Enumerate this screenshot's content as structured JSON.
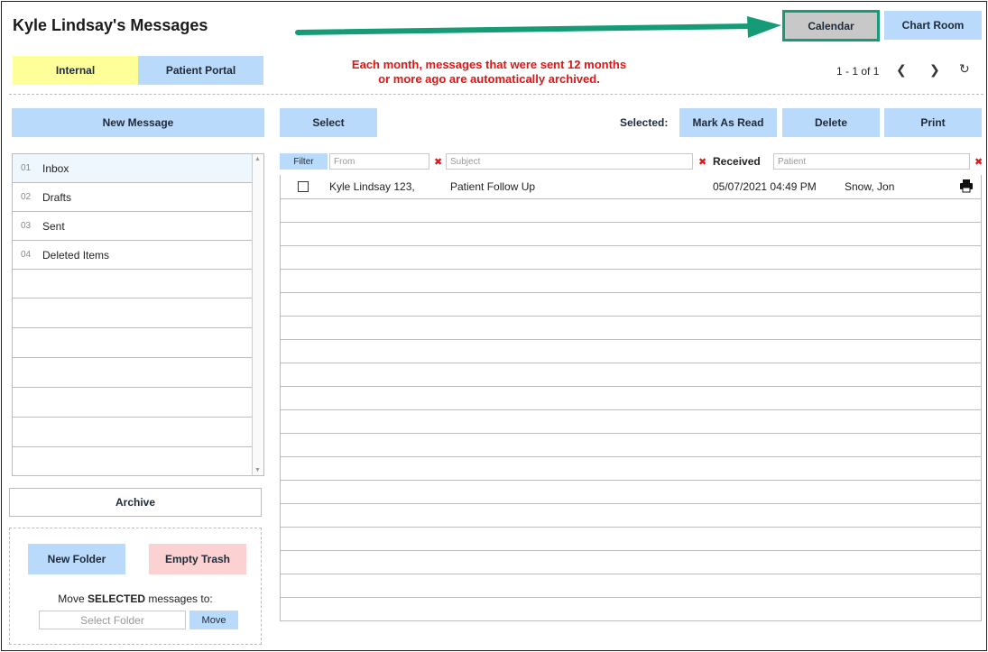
{
  "header": {
    "title": "Kyle Lindsay's Messages",
    "calendar_label": "Calendar",
    "chart_room_label": "Chart Room"
  },
  "tabs": [
    {
      "label": "Internal",
      "active": true,
      "color": "#ffff99"
    },
    {
      "label": "Patient Portal",
      "active": false,
      "color": "#b9dafa"
    }
  ],
  "archive_notice": {
    "line1": "Each month, messages that were sent 12 months",
    "line2": "or more ago are automatically archived."
  },
  "pager": {
    "range_text": "1 - 1 of 1"
  },
  "toolbar": {
    "new_message_label": "New Message",
    "select_label": "Select",
    "selected_label": "Selected:",
    "mark_as_read_label": "Mark As Read",
    "delete_label": "Delete",
    "print_label": "Print"
  },
  "filters": {
    "filter_label": "Filter",
    "from_placeholder": "From",
    "subject_placeholder": "Subject",
    "received_label": "Received",
    "patient_placeholder": "Patient"
  },
  "folders": [
    {
      "num": "01",
      "label": "Inbox",
      "selected": true
    },
    {
      "num": "02",
      "label": "Drafts",
      "selected": false
    },
    {
      "num": "03",
      "label": "Sent",
      "selected": false
    },
    {
      "num": "04",
      "label": "Deleted Items",
      "selected": false
    }
  ],
  "messages": [
    {
      "from": "Kyle Lindsay 123,",
      "subject": "Patient Follow Up",
      "received": "05/07/2021 04:49 PM",
      "patient": "Snow, Jon",
      "icon": "printer-icon"
    }
  ],
  "sidebar_bottom": {
    "archive_label": "Archive",
    "new_folder_label": "New Folder",
    "empty_trash_label": "Empty Trash",
    "move_label_prefix": "Move ",
    "move_label_bold": "SELECTED",
    "move_label_suffix": " messages to:",
    "select_folder_placeholder": "Select Folder",
    "move_button_label": "Move"
  },
  "colors": {
    "button_blue": "#b9dafa",
    "tab_yellow": "#ffff99",
    "empty_trash_pink": "#fbd1d1",
    "notice_red": "#e01515",
    "arrow_green": "#159c77",
    "calendar_gray": "#c8c8c8"
  }
}
